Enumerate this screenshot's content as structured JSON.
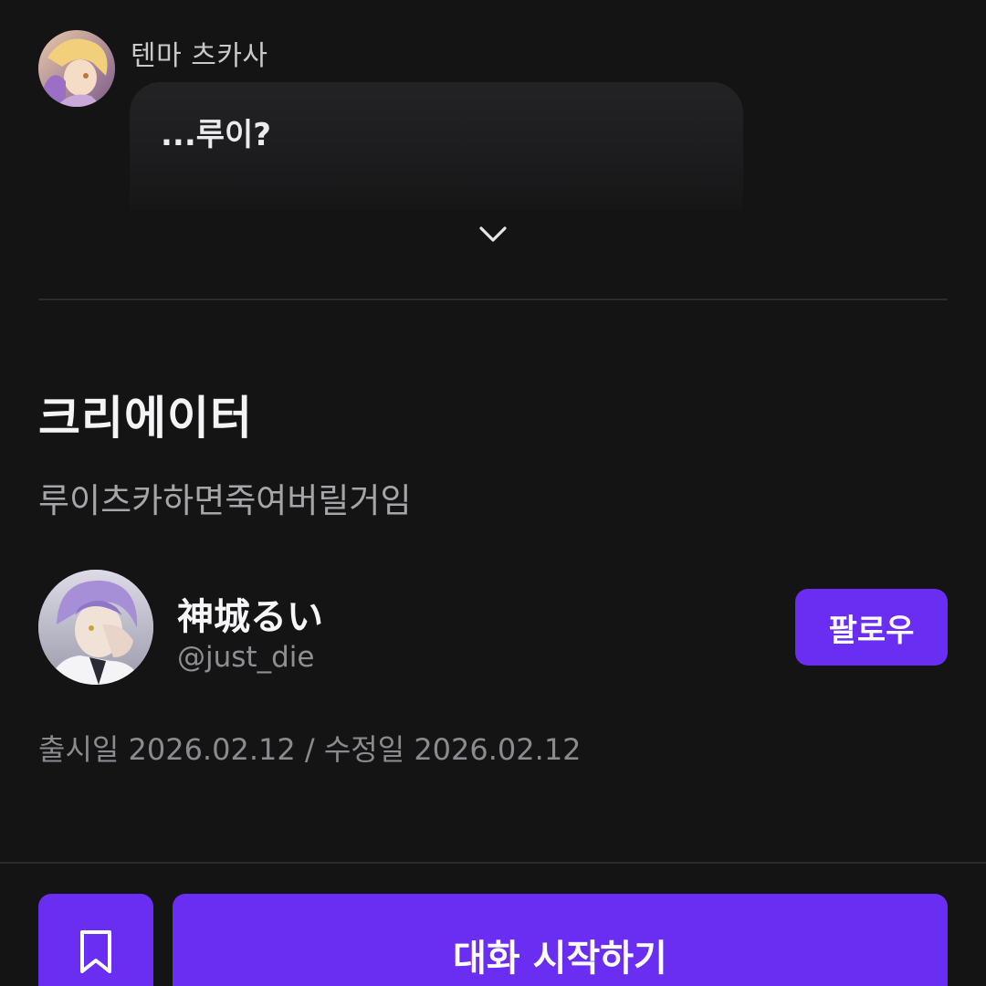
{
  "chat_preview": {
    "character_name": "텐마 츠카사",
    "message": "...루이?",
    "expand_icon": "chevron-down-icon"
  },
  "creator_section": {
    "title": "크리에이터",
    "description": "루이츠카하면죽여버릴거임",
    "creator": {
      "name": "神城るい",
      "handle": "@just_die"
    },
    "follow_label": "팔로우",
    "dates": "출시일 2026.02.12 / 수정일 2026.02.12"
  },
  "action_bar": {
    "bookmark_icon": "bookmark-icon",
    "start_chat_label": "대화 시작하기"
  },
  "colors": {
    "background": "#141415",
    "accent": "#6a2ef2",
    "muted_text": "#8a8a8f"
  }
}
